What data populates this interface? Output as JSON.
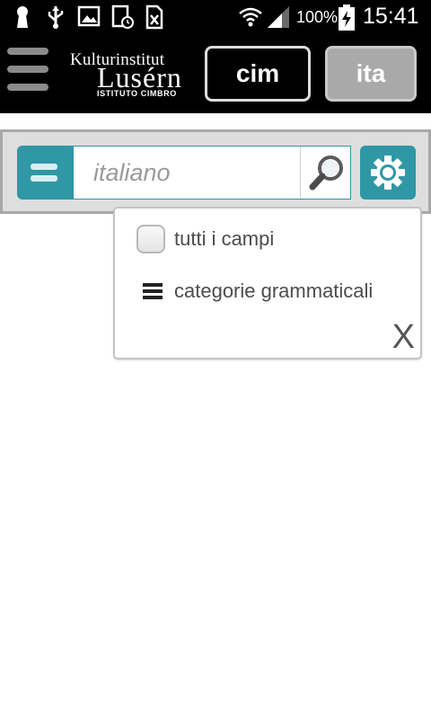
{
  "status_bar": {
    "battery_percent": "100%",
    "time": "15:41",
    "icons": [
      "lock-icon",
      "usb-icon",
      "gallery-icon",
      "sim-schedule-icon",
      "no-sim-icon",
      "wifi-icon",
      "signal-icon",
      "battery-charging-icon"
    ]
  },
  "header": {
    "logo": {
      "line1": "Kulturinstitut",
      "line2": "Lusérn",
      "line3": "ISTITUTO CIMBRO"
    },
    "lang_cim": "cim",
    "lang_ita": "ita"
  },
  "search": {
    "placeholder": "italiano",
    "value": ""
  },
  "dropdown": {
    "items": [
      {
        "label": "tutti i campi",
        "icon": "checkbox"
      },
      {
        "label": "categorie grammaticali",
        "icon": "list-icon"
      }
    ],
    "close_label": "X"
  },
  "colors": {
    "accent": "#2f97a5",
    "header_bg": "#000000",
    "panel_bg": "#dedede"
  }
}
